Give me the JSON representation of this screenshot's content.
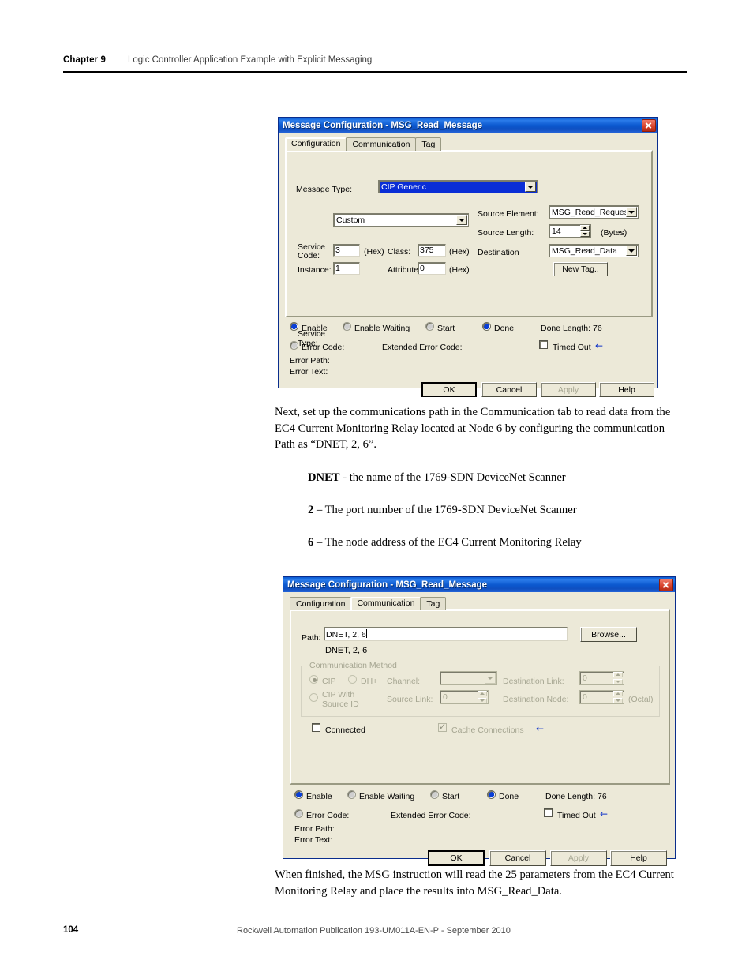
{
  "page": {
    "header": {
      "chapter": "Chapter 9",
      "title": "Logic Controller Application Example with Explicit Messaging"
    },
    "footer": {
      "page_number": "104",
      "publication": "Rockwell Automation Publication 193-UM011A-EN-P - September 2010"
    },
    "paragraphs": {
      "intro": "Next, set up the communications path in the Communication tab to read data from the EC4 Current Monitoring Relay located at Node 6 by configuring the communication Path as “DNET, 2, 6”.",
      "closing": "When finished, the MSG instruction will read the 25 parameters from the EC4 Current Monitoring Relay and place the results into MSG_Read_Data."
    },
    "bullets": [
      {
        "term": "DNET",
        "text": " - the name of the 1769-SDN DeviceNet Scanner"
      },
      {
        "term": "2",
        "text": " – The port number of the 1769-SDN DeviceNet Scanner"
      },
      {
        "term": "6",
        "text": " – The node address of the EC4 Current Monitoring Relay"
      }
    ]
  },
  "dialog1": {
    "title": "Message Configuration - MSG_Read_Message",
    "close_label": "✕",
    "tabs": [
      {
        "label": "Configuration",
        "active": true
      },
      {
        "label": "Communication",
        "active": false
      },
      {
        "label": "Tag",
        "active": false
      }
    ],
    "fields": {
      "message_type_label": "Message Type:",
      "message_type_value": "CIP Generic",
      "service_type_label": "Service\nType:",
      "service_type_label_l1": "Service",
      "service_type_label_l2": "Type:",
      "service_type_value": "Custom",
      "service_code_label_l1": "Service",
      "service_code_label_l2": "Code:",
      "service_code_value": "3",
      "service_code_hex": "(Hex)",
      "class_label": "Class:",
      "class_value": "375",
      "class_hex": "(Hex)",
      "instance_label": "Instance:",
      "instance_value": "1",
      "attribute_label": "Attribute:",
      "attribute_value": "0",
      "attribute_hex": "(Hex)",
      "source_element_label": "Source Element:",
      "source_element_value": "MSG_Read_Request",
      "source_length_label": "Source Length:",
      "source_length_value": "14",
      "source_length_units": "(Bytes)",
      "destination_label": "Destination",
      "destination_value": "MSG_Read_Data",
      "new_tag_label": "New Tag.."
    },
    "status": {
      "enable": "Enable",
      "enable_waiting": "Enable Waiting",
      "start": "Start",
      "done": "Done",
      "done_length_label": "Done Length:",
      "done_length_value": "76",
      "error_code": "Error Code:",
      "extended_error_code": "Extended Error Code:",
      "timed_out": "Timed Out",
      "error_path": "Error Path:",
      "error_text": "Error Text:"
    },
    "buttons": {
      "ok": "OK",
      "cancel": "Cancel",
      "apply": "Apply",
      "help": "Help"
    }
  },
  "dialog2": {
    "title": "Message Configuration - MSG_Read_Message",
    "close_label": "✕",
    "tabs": [
      {
        "label": "Configuration",
        "active": false
      },
      {
        "label": "Communication",
        "active": true
      },
      {
        "label": "Tag",
        "active": false
      }
    ],
    "fields": {
      "path_label": "Path:",
      "path_value": "DNET, 2, 6",
      "path_resolved": "DNET, 2, 6",
      "browse_label": "Browse...",
      "group_caption": "Communication Method",
      "cip_label": "CIP",
      "dhplus_label": "DH+",
      "cip_with_source_id_l1": "CIP With",
      "cip_with_source_id_l2": "Source ID",
      "channel_label": "Channel:",
      "channel_value": "",
      "destination_link_label": "Destination Link:",
      "destination_link_value": "0",
      "source_link_label": "Source Link:",
      "source_link_value": "0",
      "destination_node_label": "Destination Node:",
      "destination_node_value": "0",
      "octal_label": "(Octal)",
      "connected_label": "Connected",
      "cache_connections_label": "Cache Connections"
    },
    "status": {
      "enable": "Enable",
      "enable_waiting": "Enable Waiting",
      "start": "Start",
      "done": "Done",
      "done_length_label": "Done Length:",
      "done_length_value": "76",
      "error_code": "Error Code:",
      "extended_error_code": "Extended Error Code:",
      "timed_out": "Timed Out",
      "error_path": "Error Path:",
      "error_text": "Error Text:"
    },
    "buttons": {
      "ok": "OK",
      "cancel": "Cancel",
      "apply": "Apply",
      "help": "Help"
    }
  }
}
